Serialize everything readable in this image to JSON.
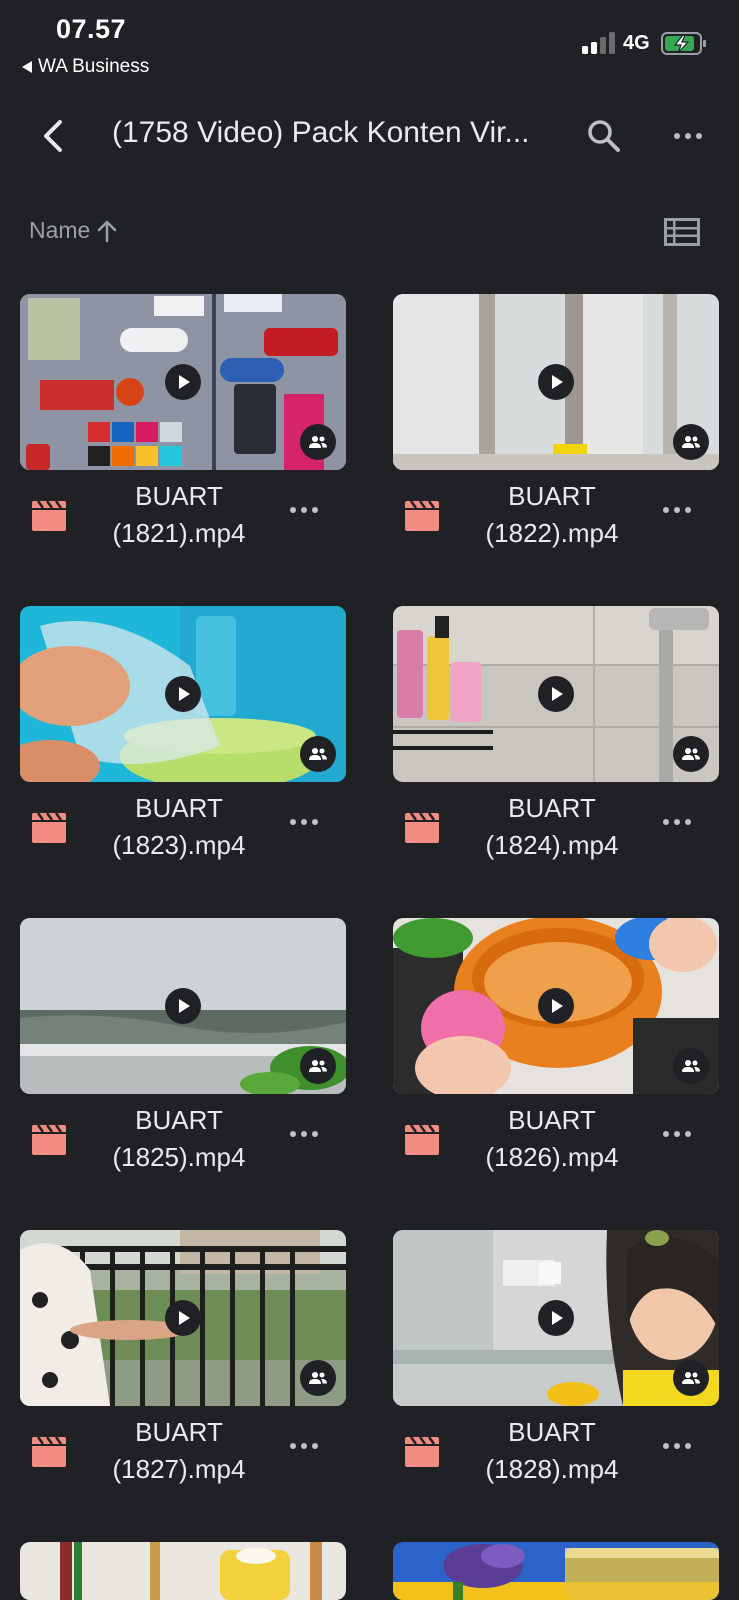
{
  "status_bar": {
    "time": "07.57",
    "back_app": "WA Business",
    "network": "4G"
  },
  "app_bar": {
    "title": "(1758 Video) Pack Konten Vir..."
  },
  "sort": {
    "label": "Name"
  },
  "colors": {
    "background": "#202124",
    "video_icon": "#f28b82",
    "battery_charge": "#34a853"
  },
  "files": [
    {
      "name_line1": "BUART",
      "name_line2": "(1821).mp4",
      "thumb": "magnets"
    },
    {
      "name_line1": "BUART",
      "name_line2": "(1822).mp4",
      "thumb": "glass-door"
    },
    {
      "name_line1": "BUART",
      "name_line2": "(1823).mp4",
      "thumb": "plastic-basket"
    },
    {
      "name_line1": "BUART",
      "name_line2": "(1824).mp4",
      "thumb": "bathroom-shelf"
    },
    {
      "name_line1": "BUART",
      "name_line2": "(1825).mp4",
      "thumb": "wall-strip"
    },
    {
      "name_line1": "BUART",
      "name_line2": "(1826).mp4",
      "thumb": "silicone-scrubber"
    },
    {
      "name_line1": "BUART",
      "name_line2": "(1827).mp4",
      "thumb": "balcony-railing"
    },
    {
      "name_line1": "BUART",
      "name_line2": "(1828).mp4",
      "thumb": "kitchen-woman"
    }
  ]
}
